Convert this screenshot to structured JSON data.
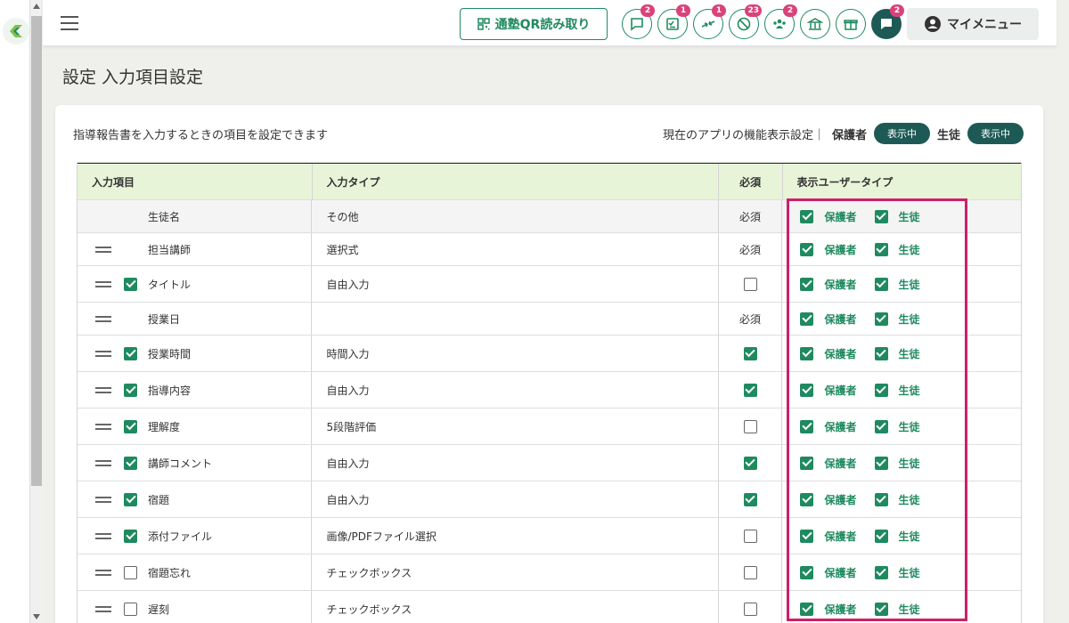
{
  "header": {
    "qr_label": "通塾QR読み取り",
    "icons": [
      {
        "name": "chat-bubble-icon",
        "badge": "2"
      },
      {
        "name": "task-checklist-icon",
        "badge": "1"
      },
      {
        "name": "swap-arrows-icon",
        "badge": "1"
      },
      {
        "name": "absence-icon",
        "badge": "23"
      },
      {
        "name": "users-group-icon",
        "badge": "2"
      },
      {
        "name": "school-building-icon",
        "badge": ""
      },
      {
        "name": "gift-icon",
        "badge": ""
      },
      {
        "name": "message-icon",
        "badge": "2"
      }
    ],
    "mymenu_label": "マイメニュー"
  },
  "page": {
    "title": "設定 入力項目設定",
    "description": "指導報告書を入力するときの項目を設定できます",
    "settings_prefix": "現在のアプリの機能表示設定｜",
    "guardian_label": "保護者",
    "guardian_status": "表示中",
    "student_label": "生徒",
    "student_status": "表示中"
  },
  "table": {
    "headers": {
      "item": "入力項目",
      "type": "入力タイプ",
      "required": "必須",
      "user_type": "表示ユーザータイプ"
    },
    "guardian_label": "保護者",
    "student_label": "生徒",
    "rows": [
      {
        "label": "生徒名",
        "type": "その他",
        "required": "必須",
        "handle": false,
        "check": "none",
        "grey": true
      },
      {
        "label": "担当講師",
        "type": "選択式",
        "required": "必須",
        "handle": true,
        "check": "none",
        "grey": false
      },
      {
        "label": "タイトル",
        "type": "自由入力",
        "required": "off",
        "handle": true,
        "check": "on",
        "grey": false
      },
      {
        "label": "授業日",
        "type": "",
        "required": "必須",
        "handle": true,
        "check": "none",
        "grey": false
      },
      {
        "label": "授業時間",
        "type": "時間入力",
        "required": "on",
        "handle": true,
        "check": "on",
        "grey": false
      },
      {
        "label": "指導内容",
        "type": "自由入力",
        "required": "on",
        "handle": true,
        "check": "on",
        "grey": false
      },
      {
        "label": "理解度",
        "type": "5段階評価",
        "required": "off",
        "handle": true,
        "check": "on",
        "grey": false
      },
      {
        "label": "講師コメント",
        "type": "自由入力",
        "required": "on",
        "handle": true,
        "check": "on",
        "grey": false
      },
      {
        "label": "宿題",
        "type": "自由入力",
        "required": "on",
        "handle": true,
        "check": "on",
        "grey": false
      },
      {
        "label": "添付ファイル",
        "type": "画像/PDFファイル選択",
        "required": "off",
        "handle": true,
        "check": "on",
        "grey": false
      },
      {
        "label": "宿題忘れ",
        "type": "チェックボックス",
        "required": "off",
        "handle": true,
        "check": "off",
        "grey": false
      },
      {
        "label": "遅刻",
        "type": "チェックボックス",
        "required": "off",
        "handle": true,
        "check": "off",
        "grey": false
      }
    ]
  },
  "colors": {
    "accent": "#1f8a5f",
    "dark": "#1e5a55",
    "highlight": "#cf1e6a",
    "badge": "#d9437a",
    "header_bg": "#e8f4d8"
  }
}
